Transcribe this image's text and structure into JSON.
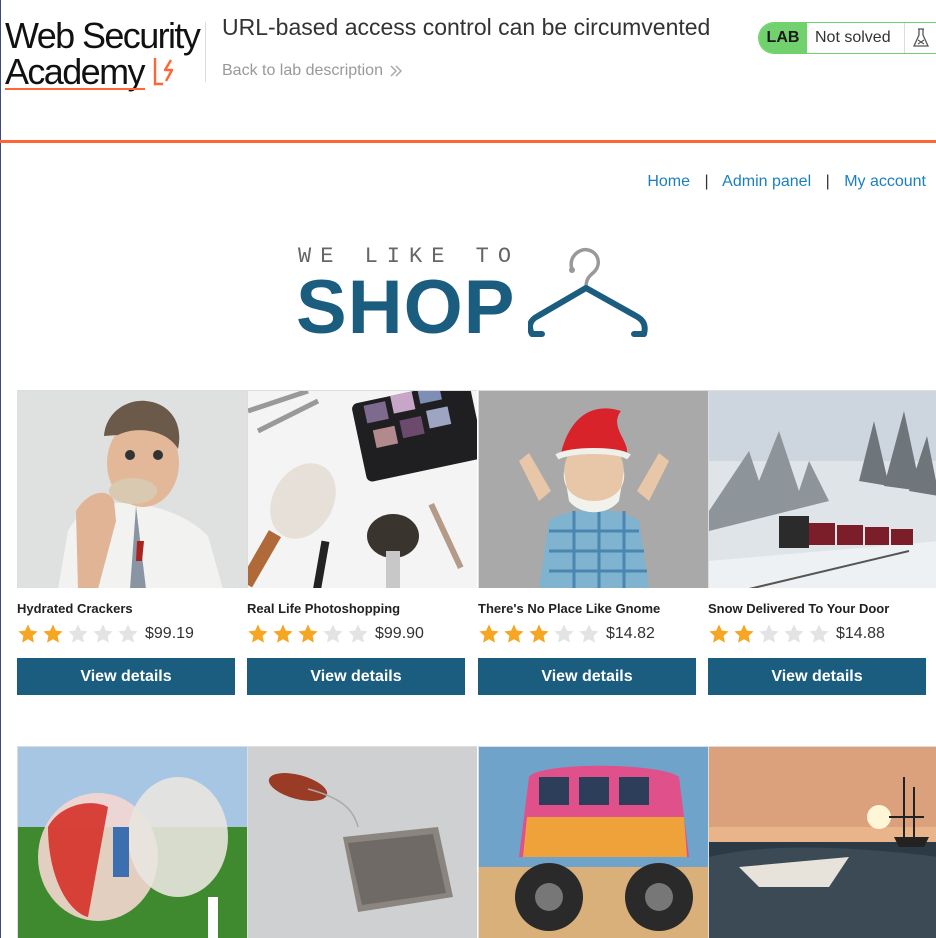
{
  "header": {
    "logo_line1": "Web Security",
    "logo_line2": "Academy",
    "lab_title": "URL-based access control can be circumvented",
    "back_link": "Back to lab description",
    "lab_badge": "LAB",
    "lab_state": "Not solved",
    "accent_color": "#ff6633",
    "badge_color": "#70d16d"
  },
  "nav": {
    "items": [
      "Home",
      "Admin panel",
      "My account"
    ],
    "separator": "|"
  },
  "banner": {
    "top_text": "WE LIKE TO",
    "main_text": "SHOP",
    "icon": "hanger-icon",
    "brand_color": "#1b5d7f"
  },
  "products": [
    {
      "title": "Hydrated Crackers",
      "rating": 2,
      "max_rating": 5,
      "price": "$99.19",
      "button": "View details",
      "image": "man-eating-cracker"
    },
    {
      "title": "Real Life Photoshopping",
      "rating": 3,
      "max_rating": 5,
      "price": "$99.90",
      "button": "View details",
      "image": "makeup-brushes"
    },
    {
      "title": "There's No Place Like Gnome",
      "rating": 3,
      "max_rating": 5,
      "price": "$14.82",
      "button": "View details",
      "image": "gnome-costume"
    },
    {
      "title": "Snow Delivered To Your Door",
      "rating": 2,
      "max_rating": 5,
      "price": "$14.88",
      "button": "View details",
      "image": "snow-train"
    },
    {
      "title": "",
      "image": "bubble-football"
    },
    {
      "title": "",
      "image": "tea-bag"
    },
    {
      "title": "",
      "image": "monster-van"
    },
    {
      "title": "",
      "image": "paper-boat-sunset"
    }
  ]
}
